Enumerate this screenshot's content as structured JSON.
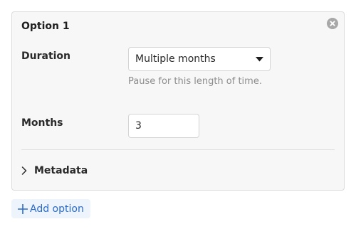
{
  "option": {
    "title": "Option 1",
    "duration_label": "Duration",
    "duration_value": "Multiple months",
    "duration_options_visible": [
      "Multiple months"
    ],
    "duration_help": "Pause for this length of time.",
    "months_label": "Months",
    "months_value": "3",
    "metadata_label": "Metadata"
  },
  "actions": {
    "add_option_label": "Add option"
  },
  "icons": {
    "close": "close-circle-icon",
    "caret": "caret-down-icon",
    "chevron": "chevron-right-icon",
    "plus": "plus-icon"
  },
  "colors": {
    "card_bg": "#f7f7f7",
    "accent": "#2a6bc9",
    "accent_bg": "#eef4fb",
    "muted_text": "#8d8d8d"
  }
}
